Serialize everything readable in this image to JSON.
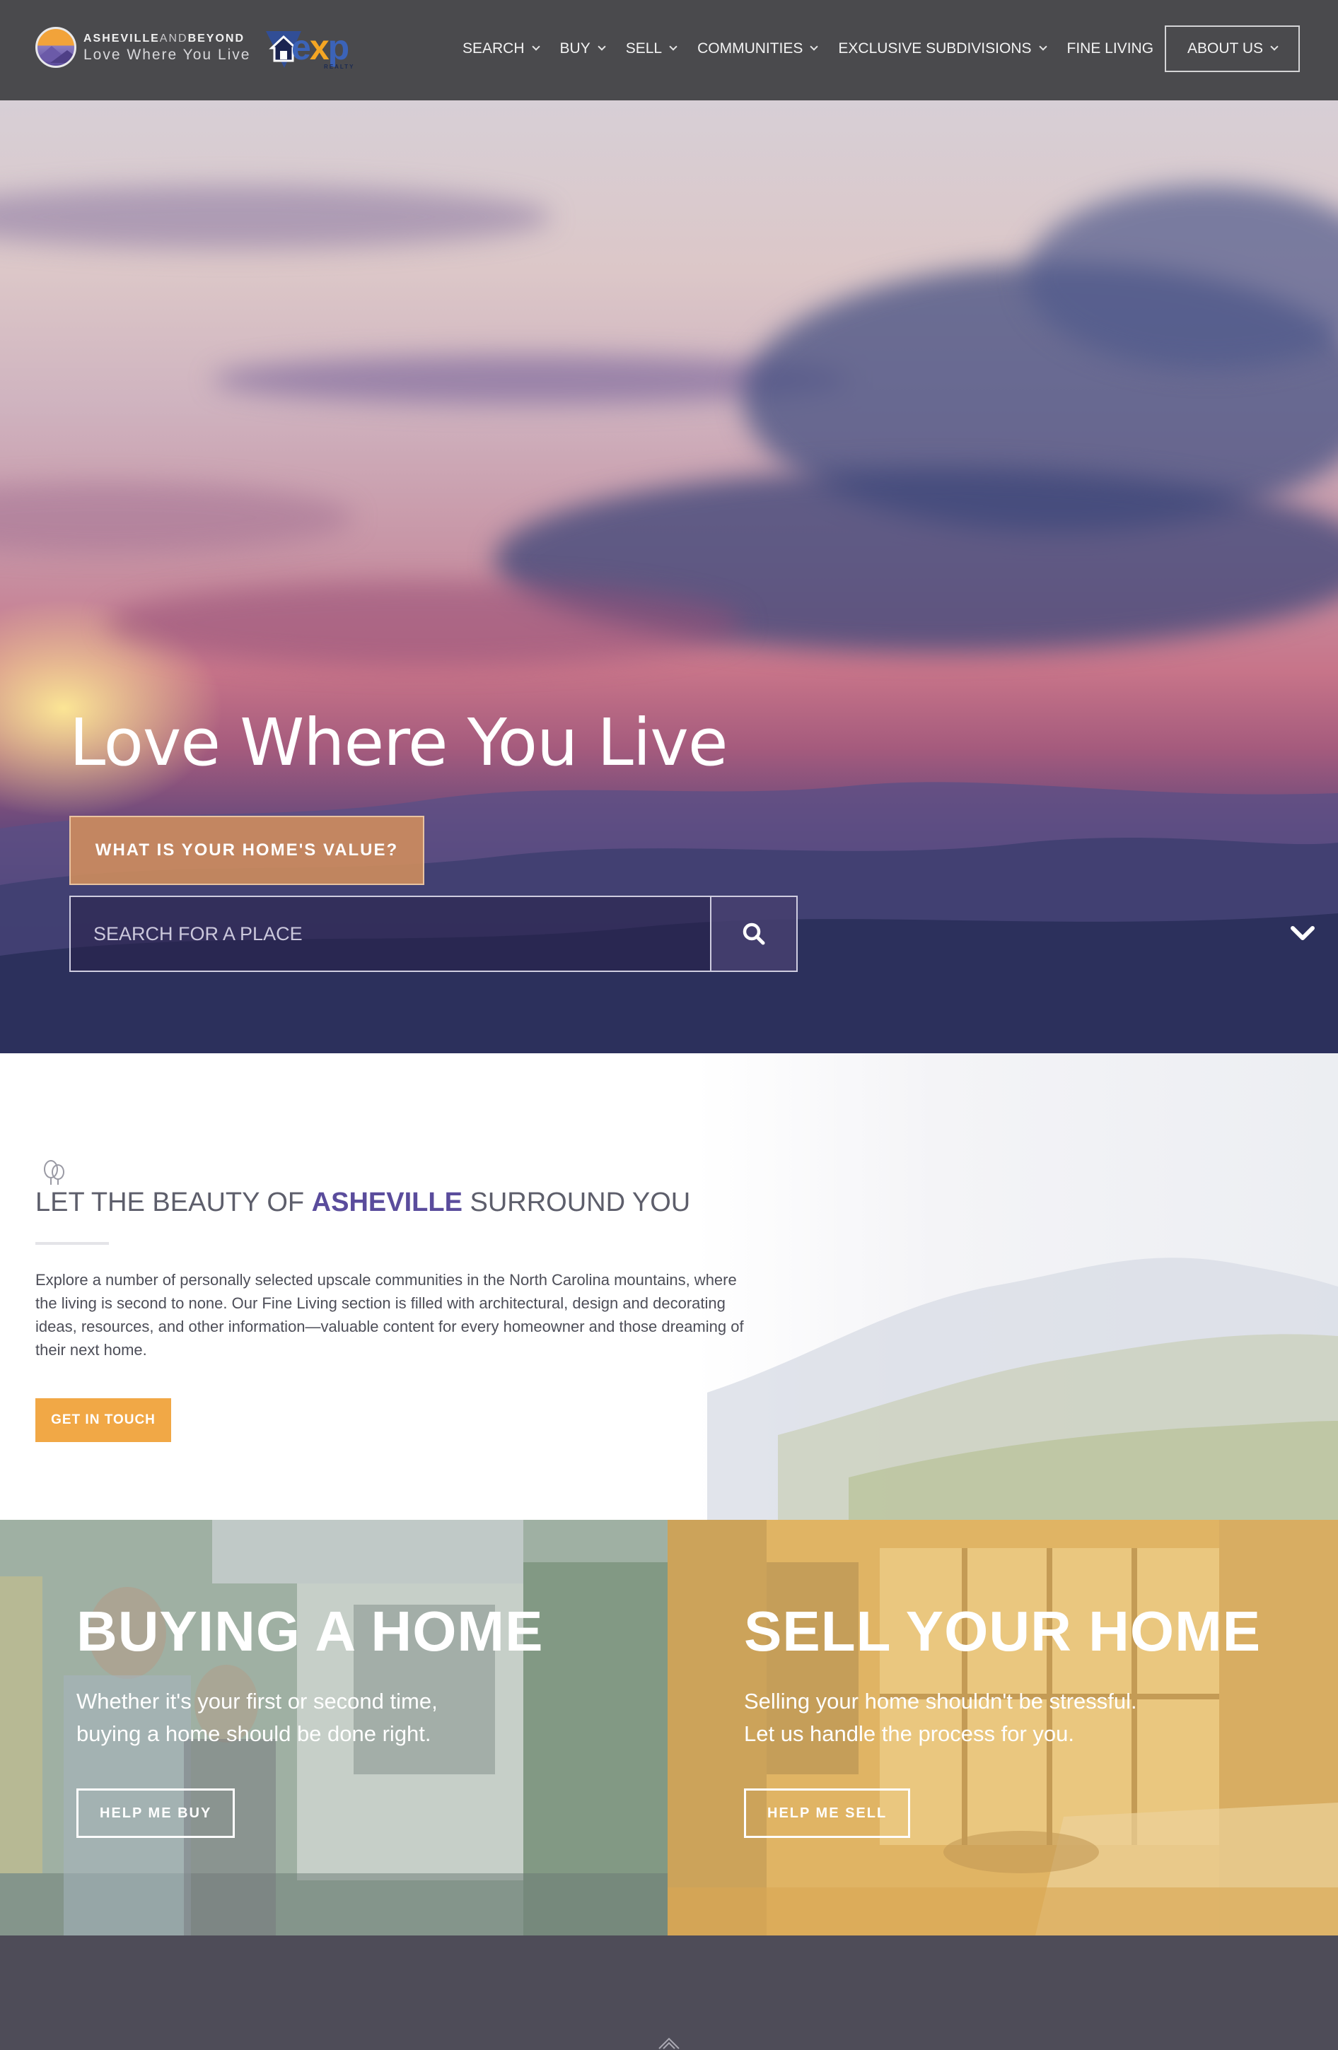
{
  "header": {
    "logo": {
      "brand_part1": "ASHEVILLE",
      "brand_and": "AND",
      "brand_part2": "BEYOND",
      "tagline": "Love Where You Live"
    },
    "partner_logo": {
      "text_e": "e",
      "text_x": "x",
      "text_p": "p",
      "sub": "REALTY"
    },
    "nav": [
      {
        "label": "SEARCH",
        "has_dropdown": true
      },
      {
        "label": "BUY",
        "has_dropdown": true
      },
      {
        "label": "SELL",
        "has_dropdown": true
      },
      {
        "label": "COMMUNITIES",
        "has_dropdown": true
      },
      {
        "label": "EXCLUSIVE SUBDIVISIONS",
        "has_dropdown": true
      },
      {
        "label": "FINE LIVING",
        "has_dropdown": false
      },
      {
        "label": "ABOUT US",
        "has_dropdown": true
      }
    ]
  },
  "hero": {
    "title": "Love Where You Live",
    "value_button": "WHAT IS YOUR HOME'S VALUE?",
    "search_placeholder": "SEARCH FOR A PLACE"
  },
  "beauty": {
    "title_pre": "LET THE BEAUTY OF ",
    "title_highlight": "ASHEVILLE",
    "title_post": " SURROUND YOU",
    "body": "Explore a number of personally selected upscale communities in the North Carolina mountains, where the living is second to none. Our Fine Living section is filled with architectural, design and decorating ideas, resources, and other information—valuable content for every homeowner and those dreaming of their next home.",
    "button": "GET IN TOUCH"
  },
  "cards": {
    "buy": {
      "title": "BUYING A HOME",
      "text": "Whether it's your first or second time,\nbuying a home should be done right.",
      "button": "HELP ME BUY"
    },
    "sell": {
      "title": "SELL YOUR HOME",
      "text": "Selling your home shouldn't be stressful.\nLet us handle the process for you.",
      "button": "HELP ME SELL"
    }
  },
  "colors": {
    "header_bg": "#4a4a4d",
    "accent_orange": "#f1a846",
    "accent_purple": "#5a4c9c",
    "buy_overlay": "#8fa396",
    "sell_overlay": "#e0b464",
    "footer_bg": "#4e4c58"
  },
  "icons": {
    "search": "search-icon",
    "scroll": "chevron-down-icon",
    "trees": "trees-icon",
    "footer_home": "house-icon"
  }
}
